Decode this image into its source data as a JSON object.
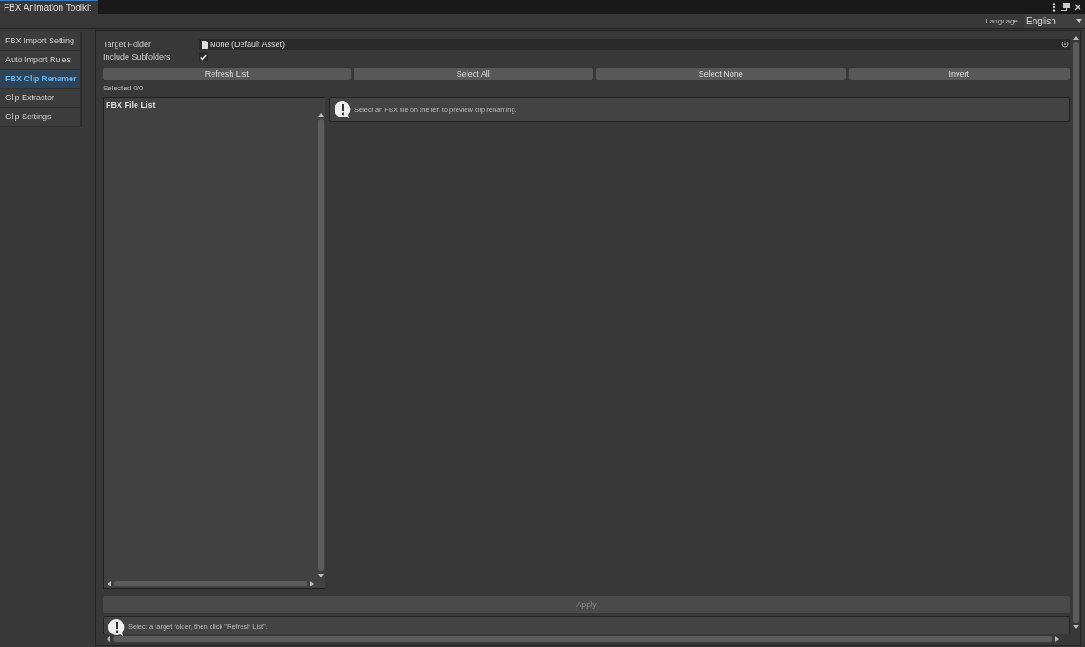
{
  "window": {
    "title": "FBX Animation Toolkit"
  },
  "toolbar": {
    "language_label": "Language",
    "language": "English"
  },
  "sidebar": {
    "items": [
      {
        "label": "FBX Import Setting",
        "selected": false
      },
      {
        "label": "Auto Import Rules",
        "selected": false
      },
      {
        "label": "FBX Clip Renamer",
        "selected": true
      },
      {
        "label": "Clip Extractor",
        "selected": false
      },
      {
        "label": "Clip Settings",
        "selected": false
      }
    ]
  },
  "form": {
    "target_folder_label": "Target Folder",
    "target_folder_value": "None (Default Asset)",
    "include_subfolders_label": "Include Subfolders",
    "include_subfolders": true
  },
  "buttons": [
    "Refresh List",
    "Select All",
    "Select None",
    "Invert"
  ],
  "selected_count": "Selected 0/0",
  "file_list": {
    "title": "FBX File List"
  },
  "preview_message": "Select an FBX file on the left to preview clip renaming.",
  "apply_button": {
    "label": "Apply",
    "disabled": true
  },
  "status_message": "Select a target folder, then click \"Refresh List\"."
}
